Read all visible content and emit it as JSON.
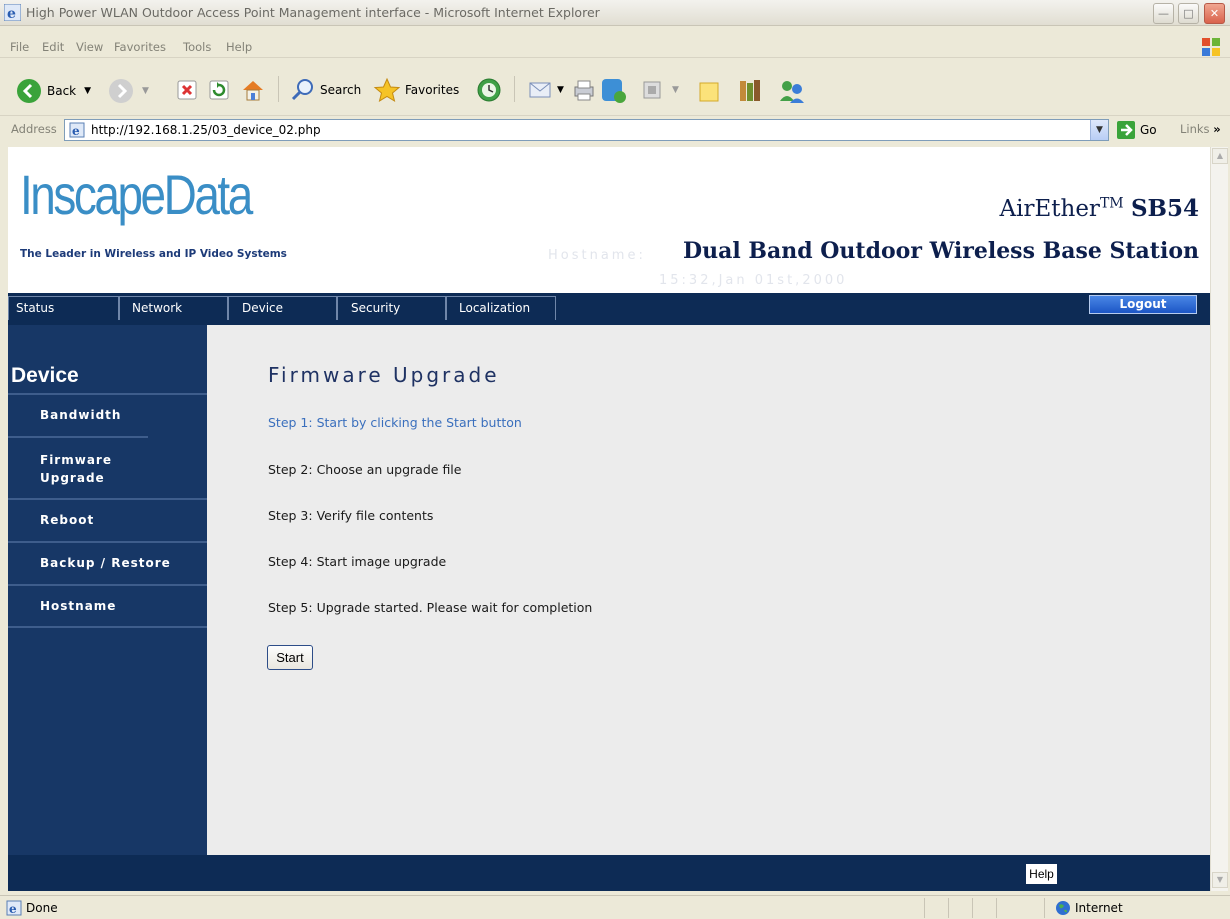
{
  "window": {
    "title": "High Power WLAN Outdoor Access Point Management interface - Microsoft Internet Explorer"
  },
  "menu": [
    "File",
    "Edit",
    "View",
    "Favorites",
    "Tools",
    "Help"
  ],
  "toolbar": {
    "back": "Back",
    "search": "Search",
    "favorites": "Favorites"
  },
  "address": {
    "label": "Address",
    "url": "http://192.168.1.25/03_device_02.php",
    "go": "Go",
    "links": "Links"
  },
  "header": {
    "logo_text": "InscapeData",
    "tagline": "The Leader in Wireless and IP Video Systems",
    "product_name": "AirEther",
    "product_tm": "TM",
    "product_model": "SB54",
    "product_desc": "Dual Band Outdoor Wireless Base Station",
    "ghost_hostname": "Hostname:",
    "ghost_time": "15:32,Jan 01st,2000"
  },
  "nav": {
    "items": [
      "Status",
      "Network",
      "Device",
      "Security",
      "Localization"
    ],
    "logout": "Logout"
  },
  "sidebar": {
    "title": "Device",
    "items": [
      "Bandwidth",
      "Firmware Upgrade",
      "Reboot",
      "Backup / Restore",
      "Hostname"
    ]
  },
  "content": {
    "title": "Firmware Upgrade",
    "steps": [
      "Step 1: Start by clicking the Start button",
      "Step 2: Choose an upgrade file",
      "Step 3: Verify file contents",
      "Step 4: Start image upgrade",
      "Step 5: Upgrade started. Please wait for completion"
    ],
    "start_button": "Start",
    "active_step_color": "#3a6fbd"
  },
  "footer": {
    "help": "Help"
  },
  "status": {
    "text": "Done",
    "zone": "Internet"
  }
}
